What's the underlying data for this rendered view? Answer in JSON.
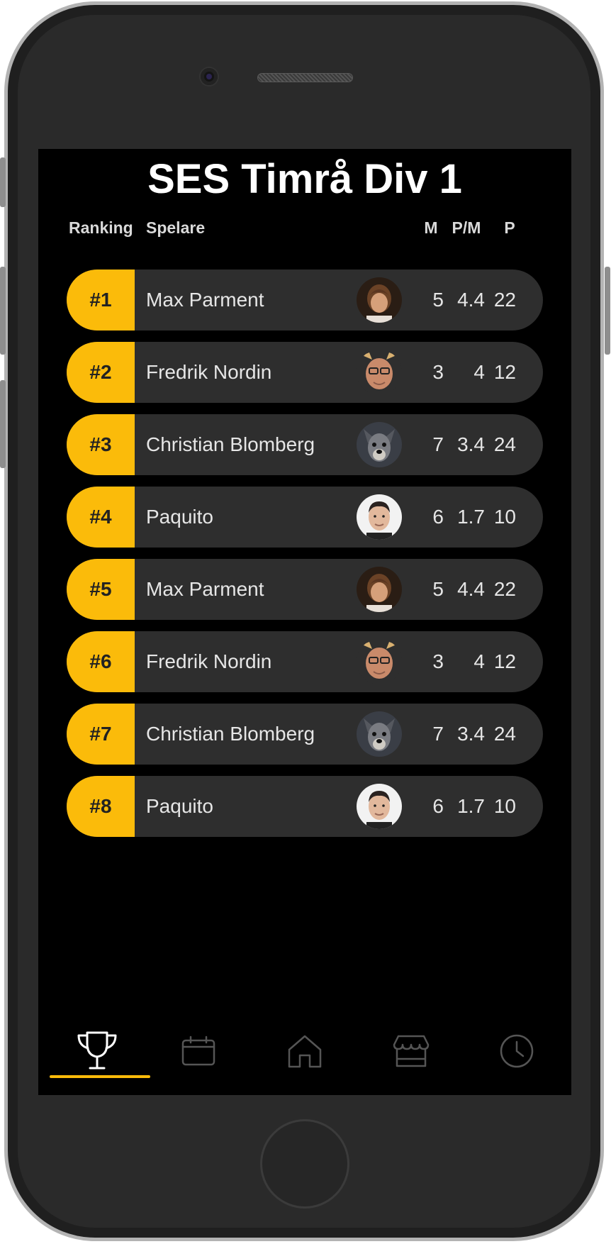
{
  "app": {
    "title": "SES Timrå Div 1"
  },
  "table": {
    "headers": {
      "ranking": "Ranking",
      "player": "Spelare",
      "m": "M",
      "pm": "P/M",
      "p": "P"
    },
    "rows": [
      {
        "rank": "#1",
        "name": "Max Parment",
        "avatar": "player-photo-young-brown-hair",
        "m": "5",
        "pm": "4.4",
        "p": "22"
      },
      {
        "rank": "#2",
        "name": "Fredrik Nordin",
        "avatar": "player-photo-glasses-bald",
        "m": "3",
        "pm": "4",
        "p": "12"
      },
      {
        "rank": "#3",
        "name": "Christian Blomberg",
        "avatar": "player-photo-dog",
        "m": "7",
        "pm": "3.4",
        "p": "24"
      },
      {
        "rank": "#4",
        "name": "Paquito",
        "avatar": "player-photo-dark-hair-white-bg",
        "m": "6",
        "pm": "1.7",
        "p": "10"
      },
      {
        "rank": "#5",
        "name": "Max Parment",
        "avatar": "player-photo-young-brown-hair",
        "m": "5",
        "pm": "4.4",
        "p": "22"
      },
      {
        "rank": "#6",
        "name": "Fredrik Nordin",
        "avatar": "player-photo-glasses-bald",
        "m": "3",
        "pm": "4",
        "p": "12"
      },
      {
        "rank": "#7",
        "name": "Christian Blomberg",
        "avatar": "player-photo-dog",
        "m": "7",
        "pm": "3.4",
        "p": "24"
      },
      {
        "rank": "#8",
        "name": "Paquito",
        "avatar": "player-photo-dark-hair-white-bg",
        "m": "6",
        "pm": "1.7",
        "p": "10"
      }
    ]
  },
  "nav": {
    "items": [
      {
        "icon": "trophy-icon",
        "active": true
      },
      {
        "icon": "calendar-icon",
        "active": false
      },
      {
        "icon": "home-icon",
        "active": false
      },
      {
        "icon": "store-icon",
        "active": false
      },
      {
        "icon": "clock-icon",
        "active": false
      }
    ]
  },
  "colors": {
    "accent": "#fbbb0a",
    "row_bg": "#2e2e2e",
    "screen_bg": "#000000",
    "text": "#e6e6e6"
  }
}
